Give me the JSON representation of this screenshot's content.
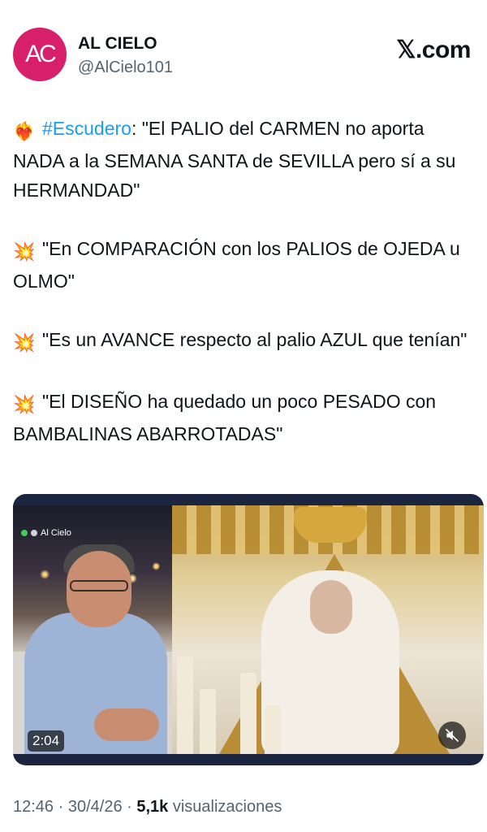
{
  "account": {
    "avatar_text": "AC",
    "display_name": "AL CIELO",
    "handle": "@AlCielo101",
    "brand": "𝕏.com"
  },
  "tweet": {
    "para1": {
      "emoji": "❤️‍🔥",
      "hashtag": "#Escudero",
      "text": ": \"El PALIO del CARMEN no aporta NADA a la SEMANA SANTA de SEVILLA pero sí a su HERMANDAD\""
    },
    "para2": {
      "emoji": "💥",
      "text": "\"En COMPARACIÓN con los PALIOS de OJEDA u OLMO\""
    },
    "para3": {
      "emoji": "💥",
      "text": "\"Es un AVANCE respecto al palio AZUL que tenían\""
    },
    "para4": {
      "emoji": "💥",
      "text": "\"El DISEÑO ha quedado un poco PESADO con BAMBALINAS ABARROTADAS\""
    }
  },
  "media": {
    "channel_label": "Al Cielo",
    "duration": "2:04",
    "mute_icon": "speaker-muted-icon"
  },
  "meta": {
    "time": "12:46",
    "separator": " · ",
    "date": "30/4/26",
    "views_count": "5,1k",
    "views_label": "visualizaciones"
  },
  "colors": {
    "avatar": "#d81f6b",
    "hashtag": "#1d9bf0",
    "secondary_text": "#536471"
  }
}
